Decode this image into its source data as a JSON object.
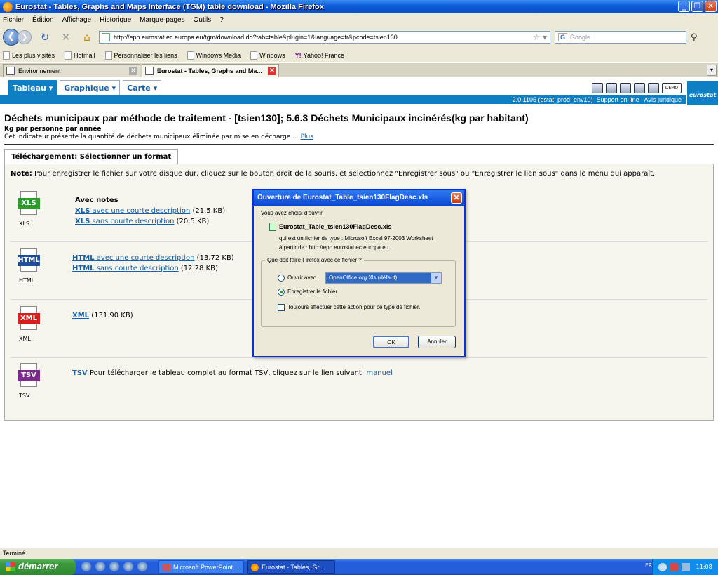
{
  "window": {
    "title": "Eurostat - Tables, Graphs and Maps Interface (TGM) table download - Mozilla Firefox"
  },
  "menubar": [
    "Fichier",
    "Édition",
    "Affichage",
    "Historique",
    "Marque-pages",
    "Outils",
    "?"
  ],
  "navbar": {
    "url": "http://epp.eurostat.ec.europa.eu/tgm/download.do?tab=table&plugin=1&language=fr&pcode=tsien130",
    "search_placeholder": "Google"
  },
  "bookmarks": [
    "Les plus visités",
    "Hotmail",
    "Personnaliser les liens",
    "Windows Media",
    "Windows",
    "Yahoo! France"
  ],
  "tabs": [
    {
      "label": "Environnement"
    },
    {
      "label": "Eurostat - Tables, Graphs and Ma..."
    }
  ],
  "eurostat": {
    "menu": [
      "Tableau",
      "Graphique",
      "Carte"
    ],
    "version": "2.0.1105 (estat_prod_env10)",
    "support": "Support on-line",
    "legal": "Avis juridique",
    "demo": "DEMO",
    "logo": "eurostat"
  },
  "page": {
    "title": "Déchets municipaux par méthode de traitement - [tsien130]; 5.6.3 Déchets Municipaux incinérés(kg par habitant)",
    "subtitle": "Kg par personne par année",
    "desc": "Cet indicateur présente la quantité de déchets municipaux éliminée par mise en décharge ... ",
    "desc_link": "Plus"
  },
  "download": {
    "tab_label": "Téléchargement: Sélectionner un format",
    "note_label": "Note:",
    "note": " Pour enregistrer le fichier sur votre disque dur, cliquez sur le bouton droit de la souris, et sélectionnez \"Enregistrer sous\" ou \"Enregistrer le lien sous\" dans le menu qui apparaît.",
    "formats": {
      "xls": {
        "caption": "XLS",
        "icon_label": "XLS",
        "heading": "Avec notes",
        "l1_code": "XLS",
        "l1_text": " avec une courte description",
        "l1_size": " (21.5 KB)",
        "l2_code": "XLS",
        "l2_text": " sans courte description",
        "l2_size": " (20.5 KB)"
      },
      "html": {
        "caption": "HTML",
        "icon_label": "HTML",
        "l1_code": "HTML",
        "l1_text": " avec une courte description",
        "l1_size": " (13.72 KB)",
        "l2_code": "HTML",
        "l2_text": " sans courte description",
        "l2_size": " (12.28 KB)"
      },
      "xml": {
        "caption": "XML",
        "icon_label": "XML",
        "l1_code": "XML",
        "l1_size": " (131.90 KB)"
      },
      "tsv": {
        "caption": "TSV",
        "icon_label": "TSV",
        "l1_code": "TSV",
        "l1_text": " Pour télécharger le tableau complet au format TSV, cliquez sur le lien suivant: ",
        "l1_link": "manuel"
      }
    }
  },
  "dialog": {
    "title": "Ouverture de Eurostat_Table_tsien130FlagDesc.xls",
    "intro": "Vous avez choisi d'ouvrir",
    "filename": "Eurostat_Table_tsien130FlagDesc.xls",
    "type_line": "qui est un fichier de type :  Microsoft Excel 97-2003 Worksheet",
    "from_line": "à partir de :  http://epp.eurostat.ec.europa.eu",
    "group_label": "Que doit faire Firefox avec ce fichier ?",
    "open_with": "Ouvrir avec",
    "open_with_value": "OpenOffice.org.Xls (défaut)",
    "save": "Enregistrer le fichier",
    "always": "Toujours effectuer cette action pour ce type de fichier.",
    "ok": "OK",
    "cancel": "Annuler"
  },
  "status": "Terminé",
  "taskbar": {
    "start": "démarrer",
    "tasks": [
      "Microsoft PowerPoint ...",
      "Eurostat - Tables, Gr..."
    ],
    "lang": "FR",
    "time": "11:08"
  }
}
